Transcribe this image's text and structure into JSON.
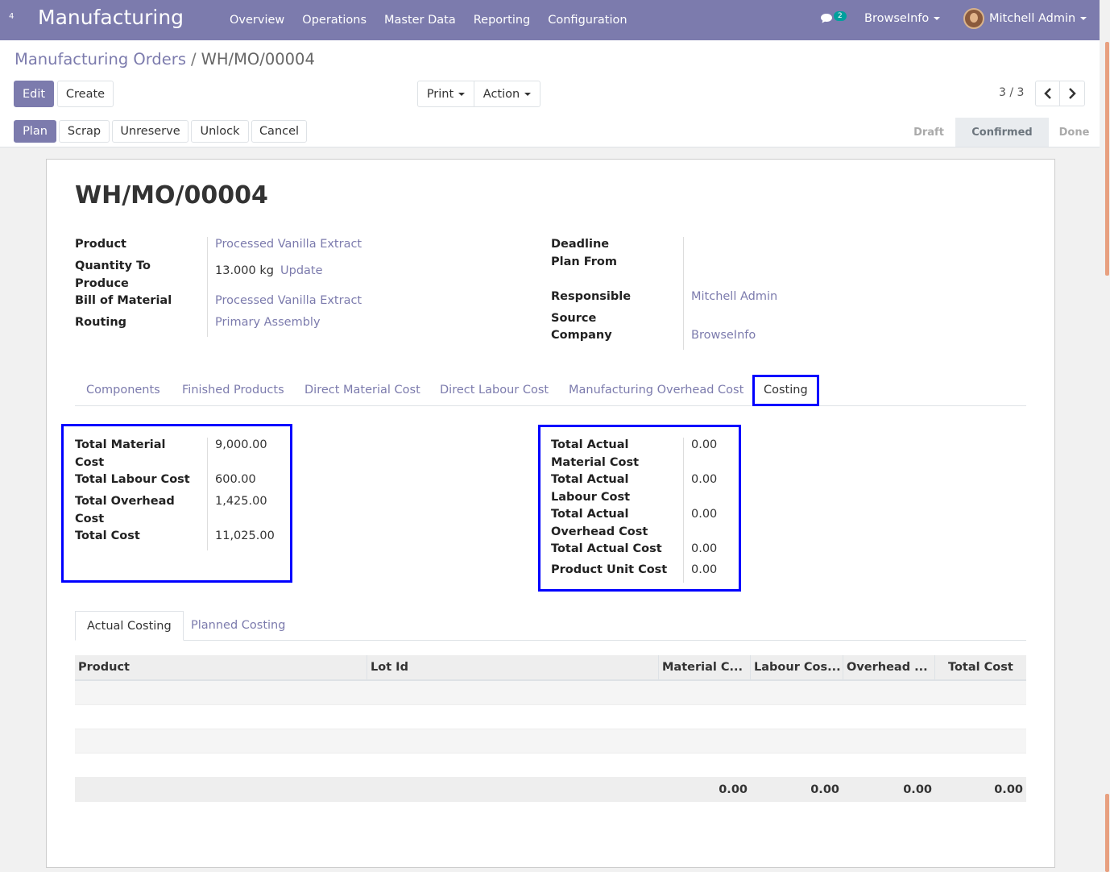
{
  "navbar": {
    "apps_count": "4",
    "brand": "Manufacturing",
    "menu": [
      "Overview",
      "Operations",
      "Master Data",
      "Reporting",
      "Configuration"
    ],
    "messages_count": "2",
    "company": "BrowseInfo",
    "user": "Mitchell Admin"
  },
  "breadcrumb": {
    "parent": "Manufacturing Orders",
    "separator": "/",
    "current": "WH/MO/00004"
  },
  "toolbar": {
    "edit": "Edit",
    "create": "Create",
    "print": "Print",
    "action": "Action",
    "pager": "3 / 3"
  },
  "actions": {
    "plan": "Plan",
    "scrap": "Scrap",
    "unreserve": "Unreserve",
    "unlock": "Unlock",
    "cancel": "Cancel"
  },
  "statusbar": [
    "Draft",
    "Confirmed",
    "Done"
  ],
  "record": {
    "name": "WH/MO/00004",
    "product_label": "Product",
    "product": "Processed Vanilla Extract",
    "qty_label_1": "Quantity To",
    "qty_label_2": "Produce",
    "qty": "13.000 kg",
    "qty_update": "Update",
    "bom_label": "Bill of Material",
    "bom": "Processed Vanilla Extract",
    "routing_label": "Routing",
    "routing": "Primary Assembly",
    "deadline_label": "Deadline",
    "plan_from_label": "Plan From",
    "responsible_label": "Responsible",
    "responsible": "Mitchell Admin",
    "source_label": "Source",
    "company_label": "Company",
    "company": "BrowseInfo"
  },
  "tabs": [
    "Components",
    "Finished Products",
    "Direct Material Cost",
    "Direct Labour Cost",
    "Manufacturing Overhead Cost",
    "Costing"
  ],
  "planned": {
    "material_label_1": "Total Material",
    "material_label_2": "Cost",
    "material": "9,000.00",
    "labour_label": "Total Labour Cost",
    "labour": "600.00",
    "overhead_label_1": "Total Overhead",
    "overhead_label_2": "Cost",
    "overhead": "1,425.00",
    "total_label": "Total Cost",
    "total": "11,025.00"
  },
  "actual": {
    "material_label_1": "Total Actual",
    "material_label_2": "Material Cost",
    "material": "0.00",
    "labour_label_1": "Total Actual",
    "labour_label_2": "Labour Cost",
    "labour": "0.00",
    "overhead_label_1": "Total Actual",
    "overhead_label_2": "Overhead Cost",
    "overhead": "0.00",
    "total_label": "Total Actual Cost",
    "total": "0.00",
    "unit_label": "Product Unit Cost",
    "unit": "0.00"
  },
  "subtabs": [
    "Actual Costing",
    "Planned Costing"
  ],
  "table": {
    "columns": [
      "Product",
      "Lot Id",
      "Material C...",
      "Labour Cos...",
      "Overhead ...",
      "Total Cost"
    ],
    "totals": [
      "0.00",
      "0.00",
      "0.00",
      "0.00"
    ]
  }
}
